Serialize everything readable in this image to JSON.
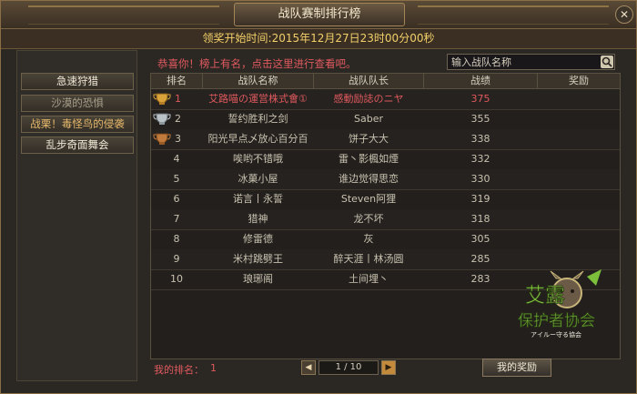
{
  "window": {
    "title": "战队赛制排行榜",
    "close_symbol": "✕"
  },
  "info": {
    "text": "领奖开始时间:2015年12月27日23时00分00秒"
  },
  "sidebar": {
    "items": [
      {
        "label": "急速狩猎"
      },
      {
        "label": "沙漠的恐惧"
      },
      {
        "label": "战栗！毒怪鸟的侵袭"
      },
      {
        "label": "乱步奇面舞会"
      }
    ]
  },
  "main": {
    "congrats": "恭喜你！榜上有名，点击这里进行查看吧。",
    "search_placeholder": "输入战队名称",
    "columns": [
      "排名",
      "战队名称",
      "战队队长",
      "战绩",
      "奖励"
    ],
    "rows": [
      {
        "rank": "1",
        "team": "艾路喵の運営株式會①",
        "captain": "感動励誌のニヤ",
        "score": "375"
      },
      {
        "rank": "2",
        "team": "誓约胜利之剑",
        "captain": "Saber",
        "score": "355"
      },
      {
        "rank": "3",
        "team": "阳光早点乄放心百分百",
        "captain": "饼子大大",
        "score": "338"
      },
      {
        "rank": "4",
        "team": "唉哟不错哦",
        "captain": "雷丶影楓如煙",
        "score": "332"
      },
      {
        "rank": "5",
        "team": "冰菓小屋",
        "captain": "谁边觉得思恋",
        "score": "330"
      },
      {
        "rank": "6",
        "team": "诺言丨永誓",
        "captain": "Steven阿狸",
        "score": "319"
      },
      {
        "rank": "7",
        "team": "猎神",
        "captain": "龙不坏",
        "score": "318"
      },
      {
        "rank": "8",
        "team": "修雷德",
        "captain": "灰",
        "score": "305"
      },
      {
        "rank": "9",
        "team": "米村跳劈王",
        "captain": "醉天涯丨林汤圆",
        "score": "285"
      },
      {
        "rank": "10",
        "team": "琅琊阁",
        "captain": "土间埋丶",
        "score": "283"
      }
    ]
  },
  "footer": {
    "my_rank_label": "我的排名：",
    "my_rank_value": "1",
    "page": "1 / 10",
    "prev_symbol": "◀",
    "next_symbol": "▶",
    "reward_button": "我的奖励"
  },
  "watermark": {
    "text_line1": "艾露",
    "text_line2": "保护者协会",
    "text_line3": "アイルー守る協会"
  },
  "colors": {
    "accent_red": "#e0595e",
    "gold": "#f3d06a",
    "panel": "#2b2824"
  }
}
